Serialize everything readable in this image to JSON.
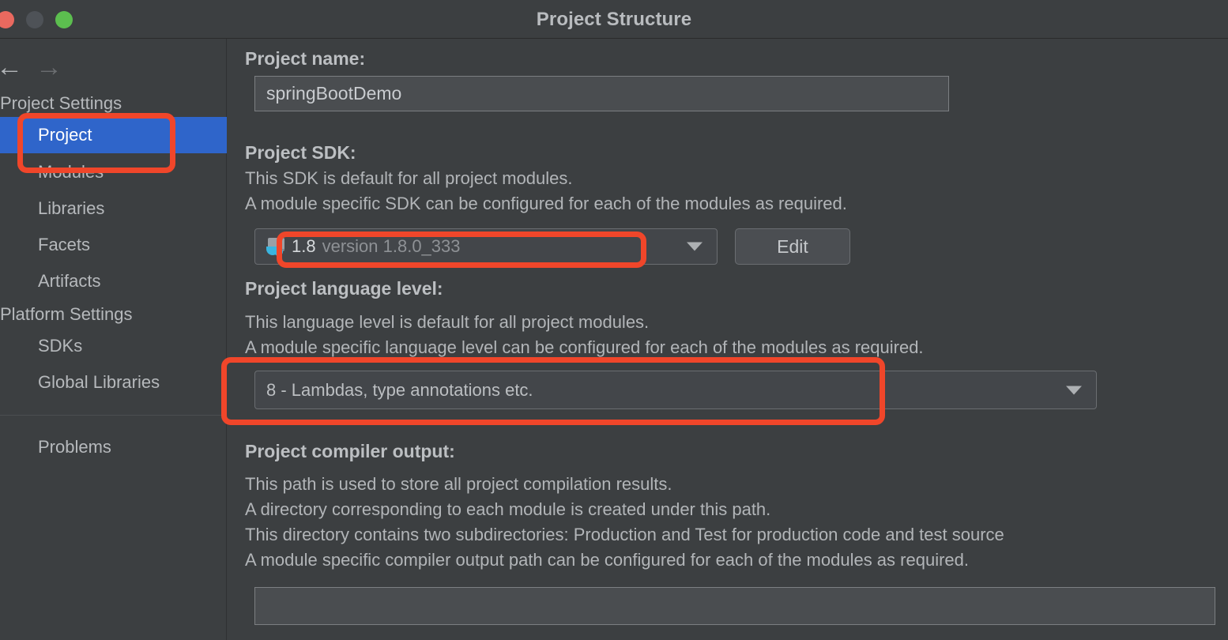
{
  "window": {
    "title": "Project Structure",
    "controls": {
      "close": "close-window",
      "minimize": "minimize-window",
      "maximize": "maximize-window"
    }
  },
  "navigation": {
    "back_icon": "←",
    "forward_icon": "→"
  },
  "sidebar": {
    "groups": [
      {
        "header": "Project Settings",
        "items": [
          {
            "label": "Project",
            "selected": true
          },
          {
            "label": "Modules",
            "selected": false
          },
          {
            "label": "Libraries",
            "selected": false
          },
          {
            "label": "Facets",
            "selected": false
          },
          {
            "label": "Artifacts",
            "selected": false
          }
        ]
      },
      {
        "header": "Platform Settings",
        "items": [
          {
            "label": "SDKs",
            "selected": false
          },
          {
            "label": "Global Libraries",
            "selected": false
          }
        ]
      }
    ],
    "footer_items": [
      {
        "label": "Problems",
        "selected": false
      }
    ]
  },
  "main": {
    "project_name": {
      "label": "Project name:",
      "value": "springBootDemo",
      "placeholder": ""
    },
    "project_sdk": {
      "label": "Project SDK:",
      "description": [
        "This SDK is default for all project modules.",
        "A module specific SDK can be configured for each of the modules as required."
      ],
      "selected_name": "1.8",
      "selected_version": "version 1.8.0_333",
      "icon": "java-sdk-icon",
      "edit_button": "Edit"
    },
    "project_language_level": {
      "label": "Project language level:",
      "description": [
        "This language level is default for all project modules.",
        "A module specific language level can be configured for each of the modules as required."
      ],
      "selected": "8 - Lambdas, type annotations etc."
    },
    "project_compiler_output": {
      "label": "Project compiler output:",
      "description": [
        "This path is used to store all project compilation results.",
        "A directory corresponding to each module is created under this path.",
        "This directory contains two subdirectories: Production and Test for production code and test source",
        "A module specific compiler output path can be configured for each of the modules as required."
      ],
      "value": "",
      "placeholder": ""
    }
  },
  "annotations": {
    "color": "#f0462a",
    "highlights": [
      {
        "target": "sidebar-item-project"
      },
      {
        "target": "project-sdk-combo"
      },
      {
        "target": "project-language-level-combo"
      }
    ]
  }
}
